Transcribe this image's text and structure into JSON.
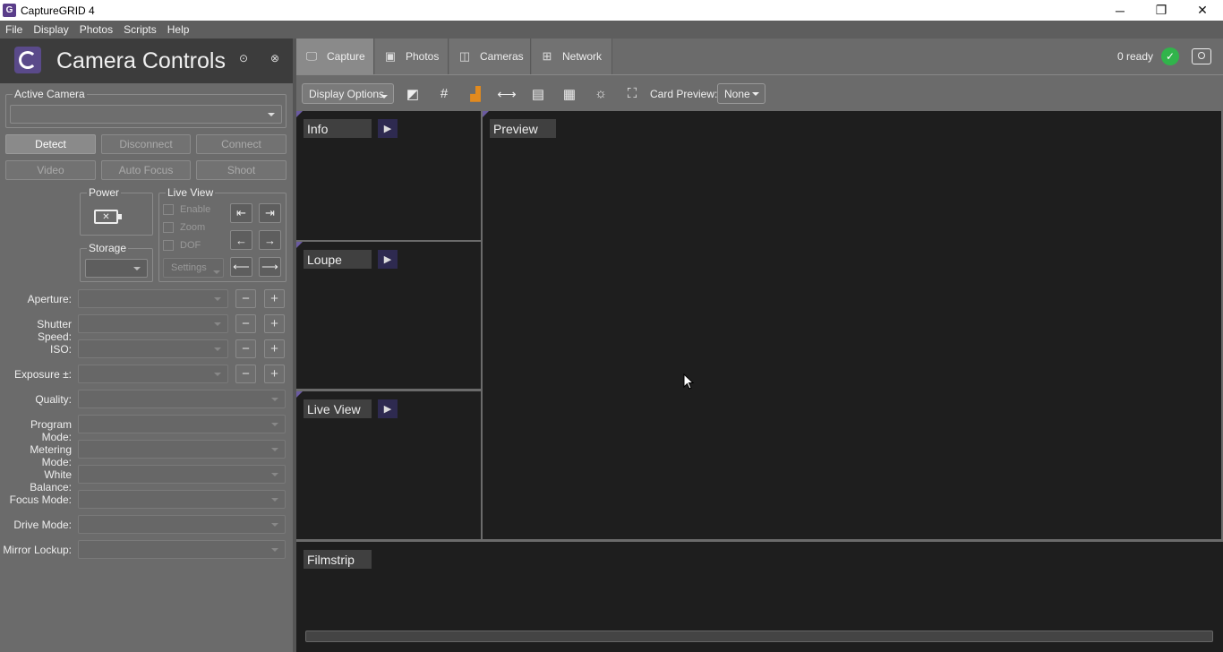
{
  "window": {
    "title": "CaptureGRID 4",
    "minimize": "─",
    "restore": "❐",
    "close": "✕"
  },
  "menu": [
    "File",
    "Display",
    "Photos",
    "Scripts",
    "Help"
  ],
  "left": {
    "title": "Camera Controls",
    "active_camera_label": "Active Camera",
    "buttons": {
      "detect": "Detect",
      "disconnect": "Disconnect",
      "connect": "Connect",
      "video": "Video",
      "auto_focus": "Auto Focus",
      "shoot": "Shoot"
    },
    "power_label": "Power",
    "storage_label": "Storage",
    "live_view_label": "Live View",
    "enable": "Enable",
    "zoom": "Zoom",
    "dof": "DOF",
    "settings": "Settings",
    "properties": [
      "Aperture:",
      "Shutter Speed:",
      "ISO:",
      "Exposure ±:",
      "Quality:",
      "Program Mode:",
      "Metering Mode:",
      "White Balance:",
      "Focus Mode:",
      "Drive Mode:",
      "Mirror Lockup:"
    ]
  },
  "tabs": [
    "Capture",
    "Photos",
    "Cameras",
    "Network"
  ],
  "status": {
    "ready": "0 ready",
    "ok_color": "#31b44b"
  },
  "toolbar": {
    "display_options": "Display Options",
    "card_preview_label": "Card Preview:",
    "card_preview_value": "None"
  },
  "panels": {
    "info": "Info",
    "loupe": "Loupe",
    "live_view": "Live View",
    "preview": "Preview",
    "filmstrip": "Filmstrip"
  }
}
